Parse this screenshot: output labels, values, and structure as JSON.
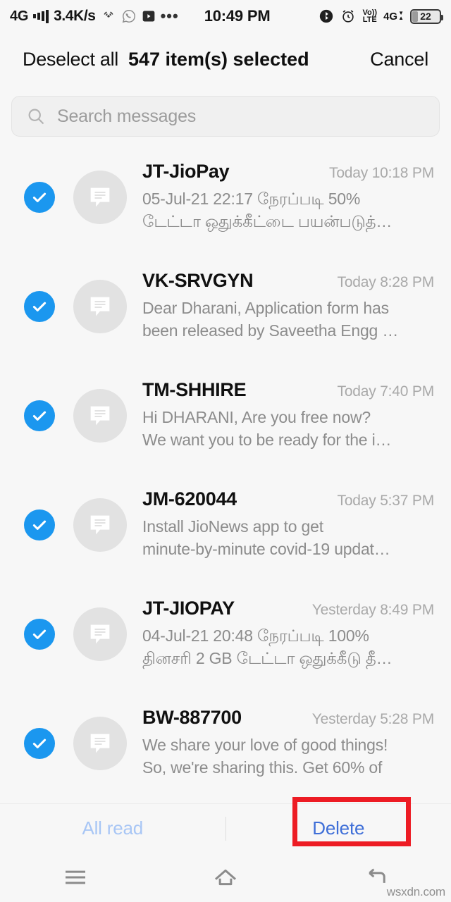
{
  "status_bar": {
    "network_type": "4G",
    "signal_icon": "signal-bars-icon",
    "data_speed": "3.4K/s",
    "hotspot_icon": "hotspot-icon",
    "whatsapp_icon": "whatsapp-icon",
    "play_icon": "play-video-icon",
    "overflow_icon": "more-dots-icon",
    "time": "10:49 PM",
    "bluetooth_icon": "bluetooth-icon",
    "alarm_icon": "alarm-clock-icon",
    "volte_top": "Vo))",
    "volte_bottom": "LTE",
    "data_network": "4G",
    "data_arrows": "data-transfer-arrows-icon",
    "battery_level": "22"
  },
  "selection_header": {
    "deselect_all_label": "Deselect all",
    "selected_count_label": "547 item(s) selected",
    "cancel_label": "Cancel"
  },
  "search": {
    "icon": "search-icon",
    "placeholder": "Search messages",
    "value": ""
  },
  "messages": [
    {
      "sender": "JT-JioPay",
      "timestamp": "Today 10:18 PM",
      "snippet_line1": "05-Jul-21 22:17 நேரப்படி 50%",
      "snippet_line2": "டேட்டா ஒதுக்கீட்டை பயன்படுத்…",
      "selected": true,
      "avatar_icon": "message-bubble-icon",
      "check_icon": "check-icon"
    },
    {
      "sender": "VK-SRVGYN",
      "timestamp": "Today 8:28 PM",
      "snippet_line1": "Dear Dharani, Application form has",
      "snippet_line2": "been released by Saveetha Engg …",
      "selected": true,
      "avatar_icon": "message-bubble-icon",
      "check_icon": "check-icon"
    },
    {
      "sender": "TM-SHHIRE",
      "timestamp": "Today 7:40 PM",
      "snippet_line1": "Hi DHARANI, Are you free now?",
      "snippet_line2": "We want you to be ready for the i…",
      "selected": true,
      "avatar_icon": "message-bubble-icon",
      "check_icon": "check-icon"
    },
    {
      "sender": "JM-620044",
      "timestamp": "Today 5:37 PM",
      "snippet_line1": "Install JioNews app to get",
      "snippet_line2": "minute-by-minute covid-19 updat…",
      "selected": true,
      "avatar_icon": "message-bubble-icon",
      "check_icon": "check-icon"
    },
    {
      "sender": "JT-JIOPAY",
      "timestamp": "Yesterday 8:49 PM",
      "snippet_line1": "04-Jul-21 20:48 நேரப்படி 100%",
      "snippet_line2": "தினசரி 2 GB டேட்டா ஒதுக்கீடு தீ…",
      "selected": true,
      "avatar_icon": "message-bubble-icon",
      "check_icon": "check-icon"
    },
    {
      "sender": "BW-887700",
      "timestamp": "Yesterday 5:28 PM",
      "snippet_line1": "We share your love of good things!",
      "snippet_line2": "So, we're sharing this. Get 60% of",
      "selected": true,
      "avatar_icon": "message-bubble-icon",
      "check_icon": "check-icon"
    }
  ],
  "action_bar": {
    "all_read_label": "All read",
    "delete_label": "Delete"
  },
  "navigation_bar": {
    "menu_icon": "menu-icon",
    "home_icon": "home-icon",
    "back_icon": "back-icon"
  },
  "watermark": "wsxdn.com",
  "colors": {
    "accent_blue": "#1b97ef",
    "delete_blue": "#3f6fd8",
    "disabled_blue": "#a8c6f5",
    "highlight_red": "#ed1c24",
    "background": "#f7f7f7"
  }
}
